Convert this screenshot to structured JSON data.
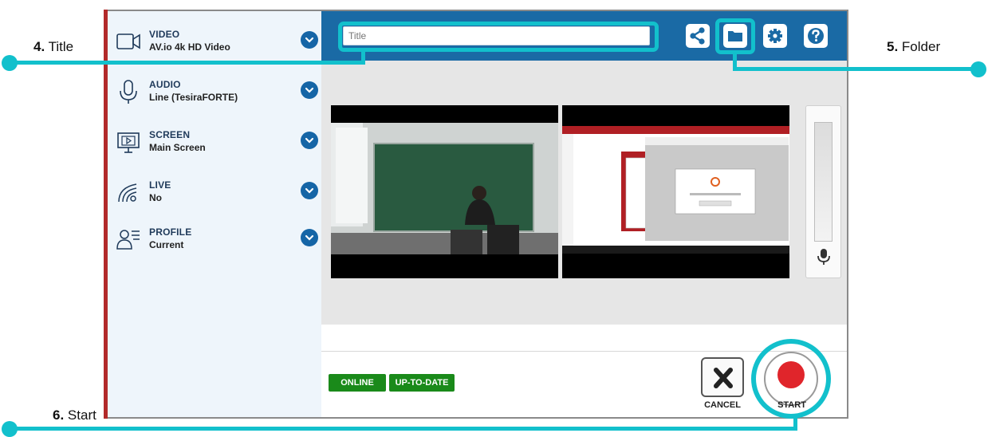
{
  "callouts": [
    {
      "number": "4.",
      "label": "Title"
    },
    {
      "number": "5.",
      "label": "Folder"
    },
    {
      "number": "6.",
      "label": "Start"
    }
  ],
  "sidebar": {
    "items": [
      {
        "label": "VIDEO",
        "value": "AV.io 4k HD Video",
        "icon": "video-camera-icon"
      },
      {
        "label": "AUDIO",
        "value": "Line (TesiraFORTE)",
        "icon": "microphone-icon"
      },
      {
        "label": "SCREEN",
        "value": "Main Screen",
        "icon": "screen-icon"
      },
      {
        "label": "LIVE",
        "value": "No",
        "icon": "live-broadcast-icon"
      },
      {
        "label": "PROFILE",
        "value": "Current",
        "icon": "profile-icon"
      }
    ]
  },
  "toolbar": {
    "title_placeholder": "Title",
    "buttons": [
      "share-icon",
      "folder-icon",
      "settings-gear-icon",
      "help-icon"
    ]
  },
  "status": {
    "online": "ONLINE",
    "uptodate": "UP-TO-DATE"
  },
  "actions": {
    "cancel": "CANCEL",
    "start": "START"
  },
  "colors": {
    "accent": "#12c0cc",
    "header": "#1a6aa5",
    "status_green": "#1a8a1a",
    "record_red": "#e0252b",
    "sidebar_bg": "#eef5fb"
  }
}
